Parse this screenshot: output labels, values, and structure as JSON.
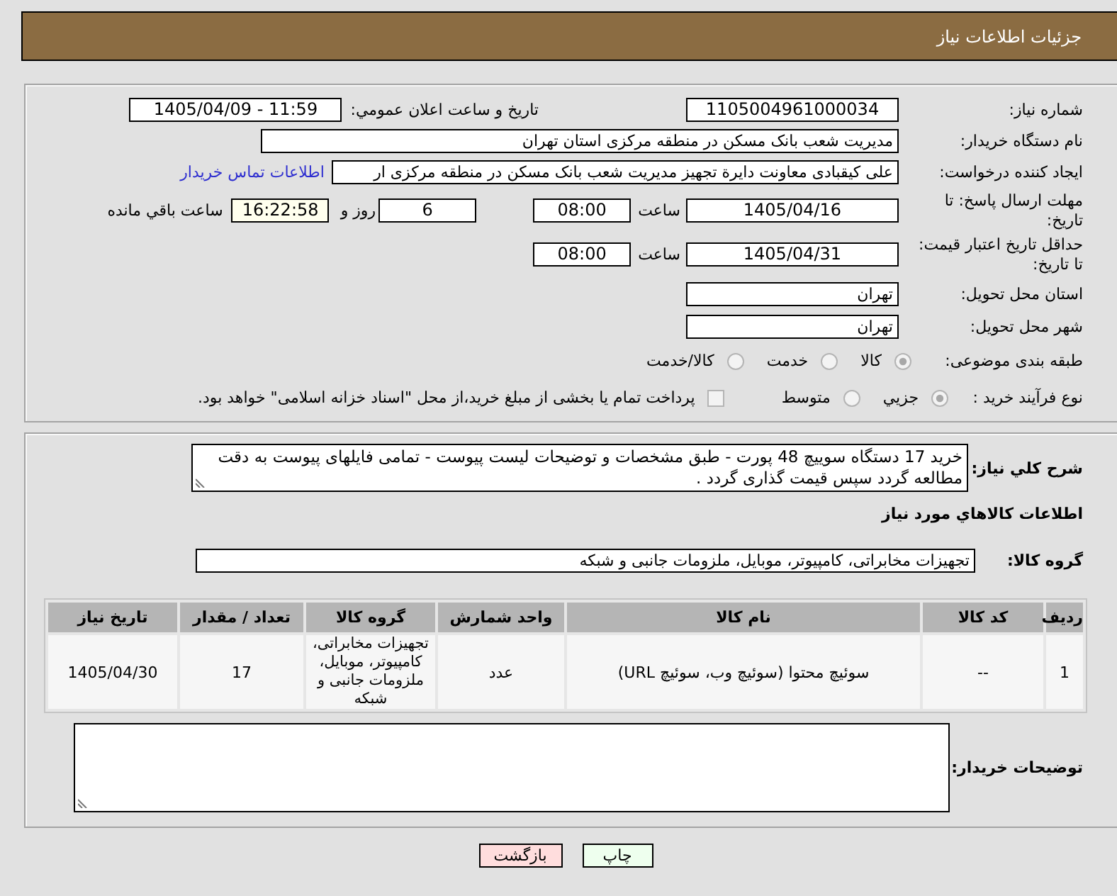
{
  "header": {
    "title": "جزئیات اطلاعات نیاز"
  },
  "need_info": {
    "need_number": {
      "label": "شماره نیاز:",
      "value": "1105004961000034"
    },
    "announcement": {
      "label": "تاریخ و ساعت اعلان عمومي:",
      "value": "1405/04/09 - 11:59"
    },
    "buyer_org": {
      "label": "نام دستگاه خریدار:",
      "value": "مدیریت شعب بانک مسکن در منطقه مرکزی استان تهران"
    },
    "requester": {
      "label": "ایجاد کننده درخواست:",
      "value": "علی کیقبادی معاونت دایرة تجهیز مدیریت شعب بانک مسکن در منطقه مرکزی ار",
      "link": "اطلاعات تماس خریدار"
    },
    "reply_deadline": {
      "label": "مهلت ارسال پاسخ: تا تاریخ:",
      "date": "1405/04/16",
      "time_label": "ساعت",
      "time": "08:00",
      "days": "6",
      "days_label": "روز و",
      "remaining": "16:22:58",
      "remaining_label": "ساعت باقي مانده"
    },
    "price_validity": {
      "label": "حداقل تاریخ اعتبار قیمت: تا تاریخ:",
      "date": "1405/04/31",
      "time_label": "ساعت",
      "time": "08:00"
    },
    "delivery_province": {
      "label": "استان محل تحویل:",
      "value": "تهران"
    },
    "delivery_city": {
      "label": "شهر محل تحویل:",
      "value": "تهران"
    },
    "subject_category": {
      "label": "طبقه بندی موضوعی:",
      "options": [
        {
          "label": "کالا",
          "selected": true
        },
        {
          "label": "خدمت",
          "selected": false
        },
        {
          "label": "کالا/خدمت",
          "selected": false
        }
      ]
    },
    "purchase_process": {
      "label": "نوع فرآیند خرید :",
      "options": [
        {
          "label": "جزيي",
          "selected": true
        },
        {
          "label": "متوسط",
          "selected": false
        }
      ],
      "treasury_payment": {
        "label": "پرداخت تمام یا بخشی از مبلغ خرید،از محل \"اسناد خزانه اسلامی\" خواهد بود.",
        "checked": false
      }
    }
  },
  "goods_info": {
    "description": {
      "label": "شرح کلي نیاز:",
      "value": "خرید 17 دستگاه سوییچ 48 پورت - طبق مشخصات و توضیحات لیست پیوست - تمامی فایلهای پیوست به دقت مطالعه گردد سپس قیمت گذاری گردد ."
    },
    "section_title": "اطلاعات کالاهاي مورد نیاز",
    "goods_group": {
      "label": "گروه کالا:",
      "value": "تجهیزات مخابراتی، کامپیوتر، موبایل، ملزومات جانبی و شبکه"
    },
    "table": {
      "columns": [
        "ردیف",
        "کد کالا",
        "نام کالا",
        "واحد شمارش",
        "گروه کالا",
        "تعداد / مقدار",
        "تاریخ نیاز"
      ],
      "rows": [
        [
          "1",
          "--",
          "سوئیچ محتوا (سوئیچ وب، سوئیچ URL)",
          "عدد",
          "تجهیزات مخابراتی، کامپیوتر، موبایل، ملزومات جانبی و شبکه",
          "17",
          "1405/04/30"
        ]
      ]
    },
    "buyer_notes": {
      "label": "توضیحات خریدار:"
    }
  },
  "buttons": [
    {
      "label": "چاپ",
      "kind": "print"
    },
    {
      "label": "بازگشت",
      "kind": "back"
    }
  ]
}
